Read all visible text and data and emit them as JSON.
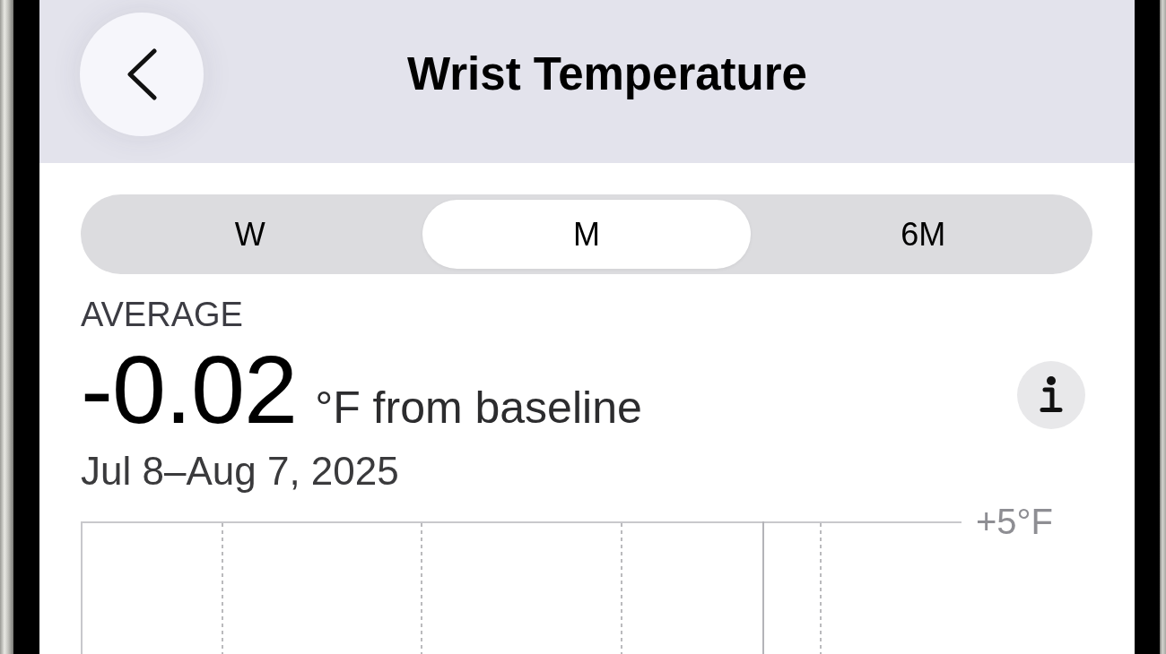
{
  "header": {
    "title": "Wrist Temperature"
  },
  "tabs": [
    {
      "label": "W",
      "selected": false
    },
    {
      "label": "M",
      "selected": true
    },
    {
      "label": "6M",
      "selected": false
    }
  ],
  "summary": {
    "label": "AVERAGE",
    "value": "-0.02",
    "unit": "°F from baseline",
    "date_range": "Jul 8–Aug 7, 2025"
  },
  "chart": {
    "y_tick_label": "+5°F"
  }
}
